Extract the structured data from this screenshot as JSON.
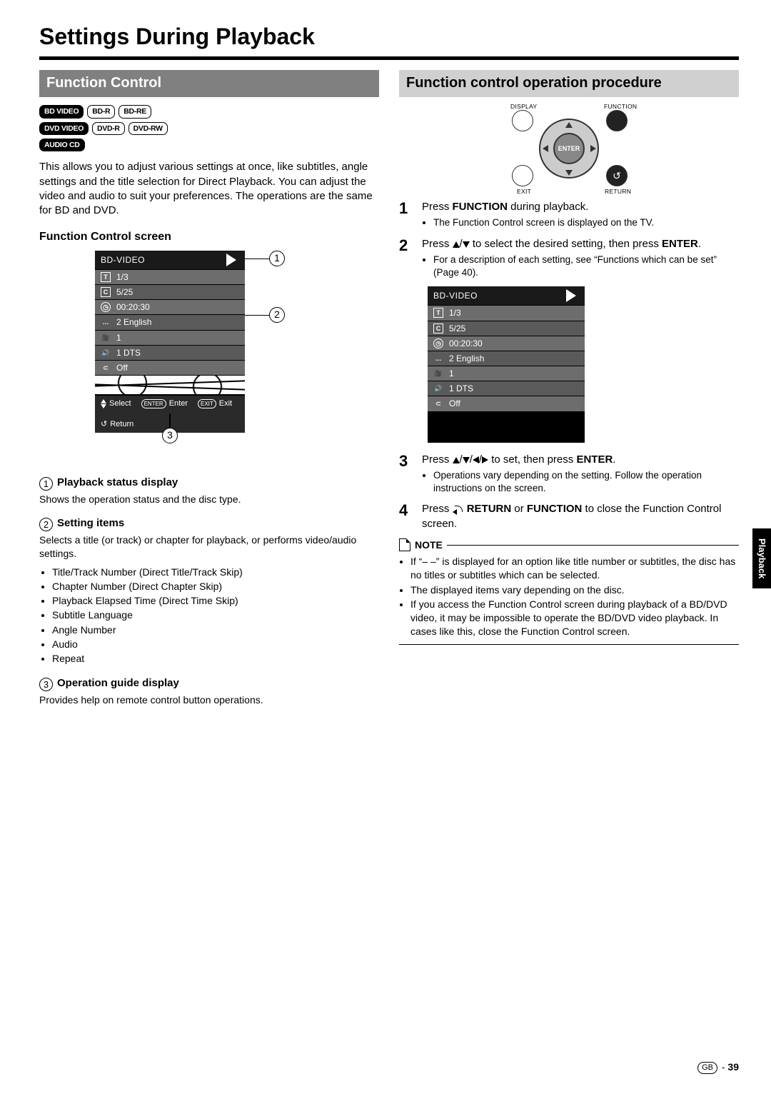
{
  "page_title": "Settings During Playback",
  "left": {
    "section_title": "Function Control",
    "formats": {
      "row1": [
        "BD VIDEO",
        "BD-R",
        "BD-RE"
      ],
      "row2": [
        "DVD VIDEO",
        "DVD-R",
        "DVD-RW"
      ],
      "row3": [
        "AUDIO CD"
      ]
    },
    "intro": "This allows you to adjust various settings at once, like subtitles, angle settings and the title selection for Direct Playback. You can adjust the video and audio to suit your preferences. The operations are the same for BD and DVD.",
    "screen_head": "Function Control screen",
    "fc": {
      "header": "BD-VIDEO",
      "rows": [
        {
          "icon": "T",
          "val": "1/3"
        },
        {
          "icon": "C",
          "val": "5/25"
        },
        {
          "icon": "clock",
          "val": "00:20:30"
        },
        {
          "icon": "sub",
          "val": "2 English"
        },
        {
          "icon": "angle",
          "val": "1"
        },
        {
          "icon": "audio",
          "val": "1 DTS"
        },
        {
          "icon": "repeat",
          "val": "Off"
        }
      ],
      "guide": {
        "select": "Select",
        "enter_pill": "ENTER",
        "enter": "Enter",
        "exit_pill": "EXIT",
        "exit": "Exit",
        "return": "Return"
      }
    },
    "callouts": {
      "c1": "1",
      "c2": "2",
      "c3": "3"
    },
    "items": [
      {
        "num": "1",
        "title": "Playback status display",
        "desc": "Shows the operation status and the disc type."
      },
      {
        "num": "2",
        "title": "Setting items",
        "desc": "Selects a title (or track) or chapter for playback, or performs video/audio settings.",
        "bullets": [
          "Title/Track Number (Direct Title/Track Skip)",
          "Chapter Number (Direct Chapter Skip)",
          "Playback Elapsed Time (Direct Time Skip)",
          "Subtitle Language",
          "Angle Number",
          "Audio",
          "Repeat"
        ]
      },
      {
        "num": "3",
        "title": "Operation guide display",
        "desc": "Provides help on remote control button operations."
      }
    ]
  },
  "right": {
    "section_title": "Function control operation procedure",
    "remote": {
      "display": "DISPLAY",
      "function": "FUNCTION",
      "enter": "ENTER",
      "exit": "EXIT",
      "return": "RETURN"
    },
    "steps": [
      {
        "n": "1",
        "body_pre": "Press ",
        "bold1": "FUNCTION",
        "body_post": " during playback.",
        "sub": [
          "The Function Control screen is displayed on the TV."
        ]
      },
      {
        "n": "2",
        "body_pre": "Press ",
        "arrows": "ud",
        "body_mid": " to select the desired setting, then press ",
        "bold1": "ENTER",
        "body_post": ".",
        "sub": [
          "For a description of each setting, see “Functions which can be set” (Page 40)."
        ]
      },
      {
        "n": "3",
        "body_pre": "Press ",
        "arrows": "udlr",
        "body_mid": " to set, then press ",
        "bold1": "ENTER",
        "body_post": ".",
        "sub": [
          "Operations vary depending on the setting. Follow the operation instructions on the screen."
        ]
      },
      {
        "n": "4",
        "body_pre": "Press ",
        "return_icon": true,
        "bold1": "RETURN",
        "body_mid2": " or ",
        "bold2": "FUNCTION",
        "body_post": " to close the Function Control screen.",
        "sub": []
      }
    ],
    "note": {
      "label": "NOTE",
      "items": [
        "If “– –” is displayed for an option like title number or subtitles, the disc has no titles or subtitles which can be selected.",
        "The displayed items vary depending on the disc.",
        "If you access the Function Control screen during playback of a BD/DVD video, it may be impossible to operate the BD/DVD video playback. In cases like this, close the Function Control screen."
      ]
    },
    "fc": {
      "header": "BD-VIDEO",
      "rows": [
        {
          "icon": "T",
          "val": "1/3"
        },
        {
          "icon": "C",
          "val": "5/25"
        },
        {
          "icon": "clock",
          "val": "00:20:30"
        },
        {
          "icon": "sub",
          "val": "2 English"
        },
        {
          "icon": "angle",
          "val": "1"
        },
        {
          "icon": "audio",
          "val": "1 DTS"
        },
        {
          "icon": "repeat",
          "val": "Off"
        }
      ]
    }
  },
  "side_tab": "Playback",
  "footer": {
    "gb": "GB",
    "dash": " - ",
    "page": "39"
  }
}
